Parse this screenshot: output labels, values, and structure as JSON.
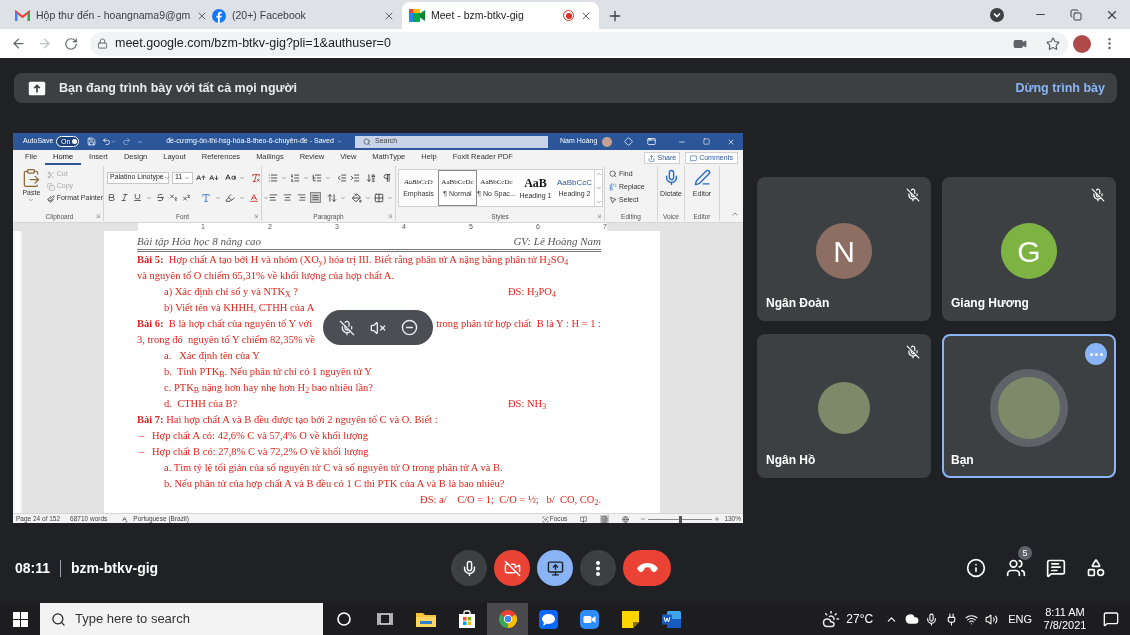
{
  "browser": {
    "tabs": [
      {
        "title": "Hộp thư đến - hoangnama9@gm",
        "selected": false,
        "media_indicator": false
      },
      {
        "title": "(20+) Facebook",
        "selected": false,
        "media_indicator": false
      },
      {
        "title": "Meet - bzm-btkv-gig",
        "selected": true,
        "media_indicator": true
      }
    ],
    "url": "meet.google.com/bzm-btkv-gig?pli=1&authuser=0"
  },
  "banner": {
    "text": "Bạn đang trình bày với tất cả mọi người",
    "action": "Dừng trình bày"
  },
  "word": {
    "autosave": {
      "label": "AutoSave",
      "state": "On",
      "on": true
    },
    "title": "đề-cương-ôn-thi-hsg-hóa-8-theo-6-chuyên-đề - Saved",
    "search_placeholder": "Search",
    "user": "Nam Hoàng",
    "menu": [
      {
        "label": "File",
        "selected": false
      },
      {
        "label": "Home",
        "selected": true
      },
      {
        "label": "Insert",
        "selected": false
      },
      {
        "label": "Design",
        "selected": false
      },
      {
        "label": "Layout",
        "selected": false
      },
      {
        "label": "References",
        "selected": false
      },
      {
        "label": "Mailings",
        "selected": false
      },
      {
        "label": "Review",
        "selected": false
      },
      {
        "label": "View",
        "selected": false
      },
      {
        "label": "MathType",
        "selected": false
      },
      {
        "label": "Help",
        "selected": false
      },
      {
        "label": "Foxit Reader PDF",
        "selected": false
      }
    ],
    "share": "Share",
    "comments": "Comments",
    "ribbon": {
      "clipboard": {
        "paste": "Paste",
        "items": [
          {
            "label": "Cut",
            "disabled": true
          },
          {
            "label": "Copy",
            "disabled": true
          },
          {
            "label": "Format Painter",
            "disabled": false
          }
        ],
        "label": "Clipboard"
      },
      "font": {
        "family": "Palatino Linotype",
        "size": "11",
        "label": "Font"
      },
      "paragraph": {
        "aligns": [
          {
            "selected": false
          },
          {
            "selected": false
          },
          {
            "selected": false
          },
          {
            "selected": true
          }
        ],
        "label": "Paragraph"
      },
      "styles": {
        "items": [
          {
            "preview": "AaBbCcD",
            "name": "Emphasis",
            "kind": "emphasis",
            "selected": false
          },
          {
            "preview": "AaBbCcDc",
            "name": "¶ Normal",
            "kind": "normal",
            "selected": true
          },
          {
            "preview": "AaBbCcDc",
            "name": "¶ No Spac...",
            "kind": "normal",
            "selected": false
          },
          {
            "preview": "AaB",
            "name": "Heading 1",
            "kind": "heading1",
            "selected": false
          },
          {
            "preview": "AaBbCcC",
            "name": "Heading 2",
            "kind": "heading2",
            "selected": false
          }
        ],
        "label": "Styles"
      },
      "editing": {
        "items": [
          "Find",
          "Replace",
          "Select"
        ],
        "label": "Editing"
      },
      "voice": {
        "button": "Dictate",
        "label": "Voice"
      },
      "editor": {
        "button": "Editor",
        "label": "Editor"
      }
    },
    "ruler_numbers": [
      "1",
      "2",
      "3",
      "4",
      "5",
      "6",
      "7"
    ],
    "document": {
      "header_left": "Bài tập Hóa học 8 nâng cao",
      "header_right": "GV: Lê Hoàng Nam",
      "lines": [
        {
          "kind": "text",
          "text": "**Bài 5:**  Hợp chất A tạo bởi H và nhóm (XO$_{y}$) hóa trị III. Biết rằng phân tử A nặng bằng phân tử H$_{2}$SO$_{4}$"
        },
        {
          "kind": "text",
          "text": "và nguyên tố O chiếm 65,31% về khối lượng của hợp chất A."
        },
        {
          "kind": "sub",
          "text": "a) Xác định chỉ số y và NTK$_{X}$ ?",
          "answer": "ĐS: H$_{3}$PO$_{4}$"
        },
        {
          "kind": "sub",
          "text": "b) Viết tên và KHHH, CTHH của A"
        },
        {
          "kind": "split",
          "text": "**Bài 6:**  B là hợp chất của nguyên tố Y với",
          "text_after": "trong phân tử hợp chất  B là Y : H = 1 :"
        },
        {
          "kind": "text",
          "text": "3, trong đó  nguyên tố Y chiếm 82,35% về"
        },
        {
          "kind": "sub",
          "text": "a.   Xác định tên của Y"
        },
        {
          "kind": "sub",
          "text": "b.  Tính PTK$_{B}$. Nếu phân tử chỉ có 1 nguyên tử Y"
        },
        {
          "kind": "sub",
          "text": "c. PTK$_{B}$ nặng hơn hay nhẹ hơn H$_{2}$ bao nhiêu lần?"
        },
        {
          "kind": "sub",
          "text": "d.  CTHH của B?",
          "answer": "ĐS: NH$_{3}$"
        },
        {
          "kind": "text",
          "text": "**Bài 7:** Hai hợp chất A và B đều được tạo bởi 2 nguyên tố C và O. Biết :"
        },
        {
          "kind": "bullet",
          "marker": "–",
          "text": "Hợp chất A có: 42,6% C và 57,4% O về khối lượng"
        },
        {
          "kind": "bullet",
          "marker": "–",
          "text": "Hợp chất B có: 27,8% C và 72,2% O về khối lượng"
        },
        {
          "kind": "sub",
          "text": "a. Tìm tỷ lệ tối giản của số nguyên tử C và số nguyên tử O trong phân tử A và B."
        },
        {
          "kind": "sub",
          "text": "b. Nếu phân tử của hợp chất A và B đều có 1 C thì PTK của A và B là bao nhiêu?"
        },
        {
          "kind": "answer",
          "text": "ĐS: a/    C/O = 1;  C/O = ½;   b/  CO, CO$_{2}$."
        }
      ]
    },
    "status": {
      "page": "Page 24 of 152",
      "words": "68710 words",
      "language": "Portuguese (Brazil)",
      "focus": "Focus",
      "views": [
        {
          "selected": false
        },
        {
          "selected": true
        },
        {
          "selected": false
        }
      ],
      "zoom_slider": {
        "level": 0.5
      },
      "zoom": "130%"
    }
  },
  "participants": [
    {
      "name": "Ngân Đoàn",
      "kind": "initial",
      "initial": "N",
      "color": "#8d6e63",
      "muted": true,
      "selected": false
    },
    {
      "name": "Giang Hương",
      "kind": "initial",
      "initial": "G",
      "color": "#7cb342",
      "muted": true,
      "selected": false
    },
    {
      "name": "Ngân Hồ",
      "kind": "photo",
      "muted": true,
      "selected": false
    },
    {
      "name": "Bạn",
      "kind": "photo",
      "muted": false,
      "selected": true
    }
  ],
  "call": {
    "time": "08:11",
    "meeting_code": "bzm-btkv-gig",
    "mic_on": true,
    "camera_on": false,
    "presenting": true,
    "people_count": "5"
  },
  "taskbar": {
    "search_placeholder": "Type here to search",
    "apps": [
      {
        "selected": false
      },
      {
        "selected": false
      },
      {
        "selected": true
      },
      {
        "selected": false
      },
      {
        "selected": false
      },
      {
        "selected": false
      },
      {
        "selected": false
      }
    ],
    "temperature": "27°C",
    "language": "ENG",
    "time": "8:11 AM",
    "date": "7/8/2021"
  }
}
